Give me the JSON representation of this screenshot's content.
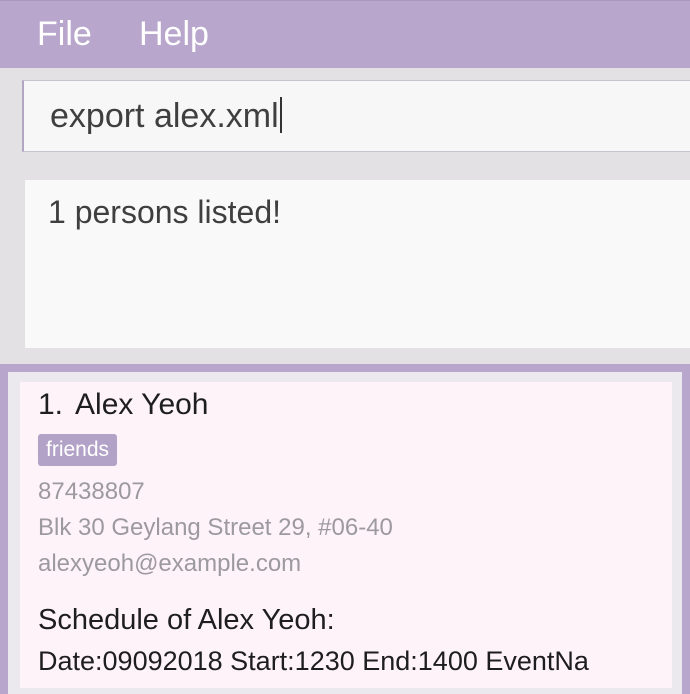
{
  "menu": {
    "file": "File",
    "help": "Help"
  },
  "command_box": {
    "value": "export alex.xml"
  },
  "result_display": {
    "text": "1 persons listed!"
  },
  "person_list": [
    {
      "index": "1.",
      "name": "Alex Yeoh",
      "tags": [
        "friends"
      ],
      "phone": "87438807",
      "address": "Blk 30 Geylang Street 29, #06-40",
      "email": "alexyeoh@example.com",
      "schedule_title": "Schedule of Alex Yeoh:",
      "schedule_entries": [
        "Date:09092018 Start:1230 End:1400 EventNa"
      ]
    }
  ],
  "colors": {
    "menubar": "#b8a6cc",
    "tag": "#b3a2c8",
    "card_background": "#fff3fa"
  }
}
